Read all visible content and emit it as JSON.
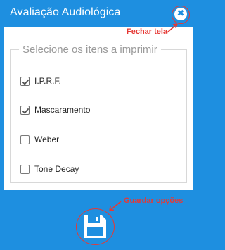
{
  "window": {
    "title": "Avaliação Audiológica",
    "close_icon": "close-icon"
  },
  "print_options": {
    "legend": "Selecione os itens a imprimir",
    "items": [
      {
        "label": "I.P.R.F.",
        "checked": true
      },
      {
        "label": "Mascaramento",
        "checked": true
      },
      {
        "label": "Weber",
        "checked": false
      },
      {
        "label": "Tone Decay",
        "checked": false
      }
    ]
  },
  "footer": {
    "save_icon": "floppy-disk-icon"
  },
  "annotations": {
    "close": "Fechar tela",
    "save": "Guardar opções",
    "color": "#e53935"
  },
  "colors": {
    "primary": "#1e8fe0",
    "panel": "#ffffff"
  }
}
